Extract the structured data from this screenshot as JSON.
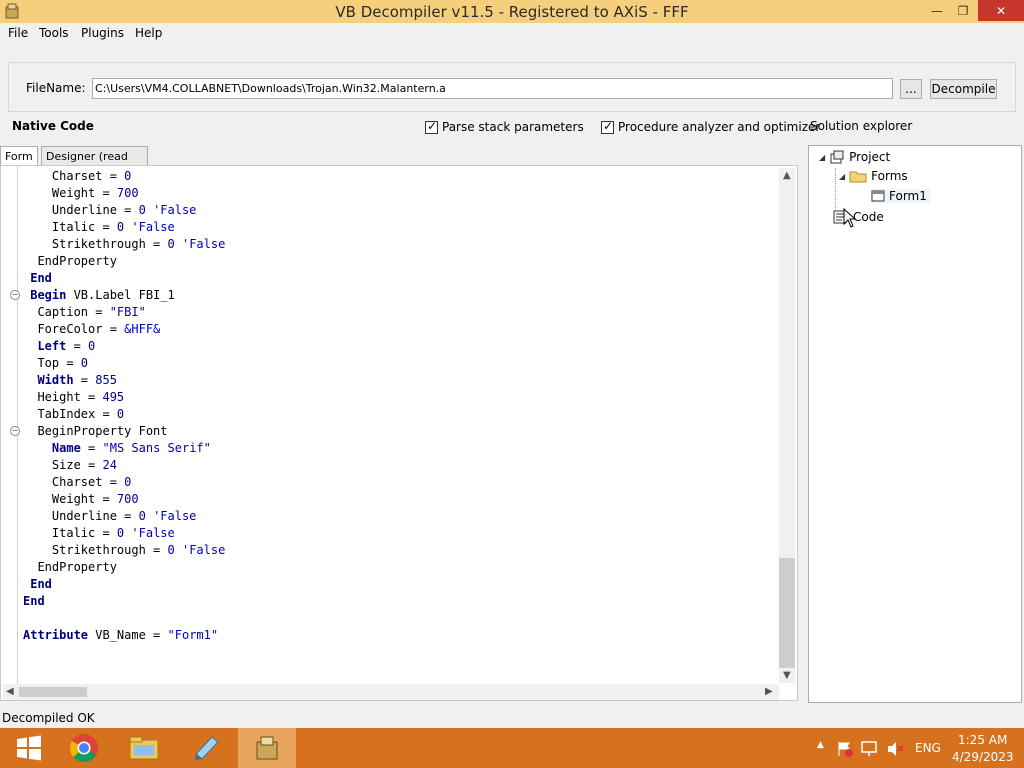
{
  "window": {
    "title": "VB Decompiler v11.5 - Registered to AXiS - FFF",
    "min_glyph": "—",
    "max_glyph": "❐",
    "close_glyph": "✕"
  },
  "menu": [
    "File",
    "Tools",
    "Plugins",
    "Help"
  ],
  "filename": {
    "label": "FileName:",
    "value": "C:\\Users\\VM4.COLLABNET\\Downloads\\Trojan.Win32.Malantern.a",
    "browse_label": "...",
    "decompile_label": "Decompile"
  },
  "options": {
    "native_code_label": "Native Code",
    "parse_stack_label": "Parse stack parameters",
    "parse_stack_checked": true,
    "procedure_analyzer_label": "Procedure analyzer and optimizer",
    "procedure_analyzer_checked": true,
    "solution_explorer_label": "Solution explorer"
  },
  "tabs": [
    "Form",
    "Designer (read only)"
  ],
  "code_lines": [
    "    Charset = 0",
    "    Weight = 700",
    "    Underline = 0 'False",
    "    Italic = 0 'False",
    "    Strikethrough = 0 'False",
    "  EndProperty",
    " End",
    " Begin VB.Label FBI_1",
    "  Caption = \"FBI\"",
    "  ForeColor = &HFF&",
    "  Left = 0",
    "  Top = 0",
    "  Width = 855",
    "  Height = 495",
    "  TabIndex = 0",
    "  BeginProperty Font",
    "    Name = \"MS Sans Serif\"",
    "    Size = 24",
    "    Charset = 0",
    "    Weight = 700",
    "    Underline = 0 'False",
    "    Italic = 0 'False",
    "    Strikethrough = 0 'False",
    "  EndProperty",
    " End",
    "End",
    "",
    "Attribute VB_Name = \"Form1\""
  ],
  "solution_tree": {
    "project": "Project",
    "forms": "Forms",
    "form1": "Form1",
    "code": "Code"
  },
  "status": "Decompiled OK",
  "taskbar": {
    "lang": "ENG",
    "time": "1:25 AM",
    "date": "4/29/2023"
  },
  "colors": {
    "titlebar": "#f5cf7c",
    "taskbar": "#d6721d",
    "close_button": "#c7352b"
  }
}
